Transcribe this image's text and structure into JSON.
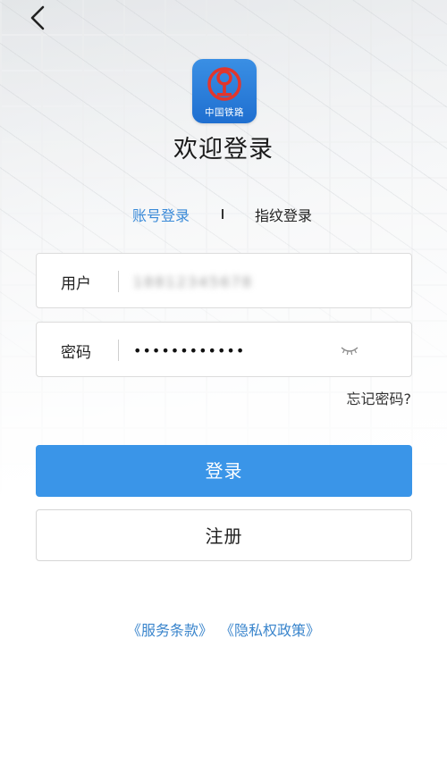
{
  "header": {
    "back_icon": "chevron-left-icon"
  },
  "logo": {
    "caption": "中国铁路",
    "icon": "china-railway-logo",
    "background": "#2b7fde"
  },
  "page_title": "欢迎登录",
  "tabs": [
    {
      "label": "账号登录",
      "active": true
    },
    {
      "label": "指纹登录",
      "active": false
    }
  ],
  "form": {
    "username": {
      "label": "用户",
      "value": "18812345678"
    },
    "password": {
      "label": "密码",
      "value": "••••••••••••",
      "toggle_icon": "eye-closed-icon"
    },
    "forgot_label": "忘记密码?"
  },
  "buttons": {
    "login_label": "登录",
    "register_label": "注册"
  },
  "terms": {
    "service_link": "《服务条款》",
    "privacy_link": "《隐私权政策》"
  },
  "colors": {
    "accent": "#3a95e8",
    "link": "#3a85cc",
    "tab_active": "#3a8ad8"
  }
}
